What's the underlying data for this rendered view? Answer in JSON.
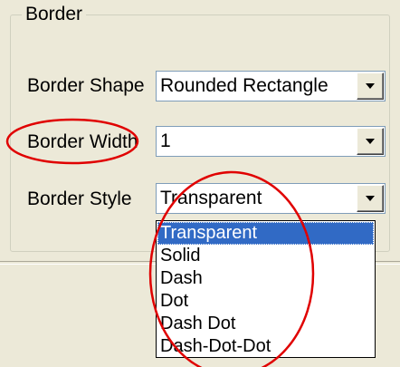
{
  "group": {
    "title": "Border"
  },
  "fields": {
    "shape": {
      "label": "Border Shape",
      "value": "Rounded Rectangle"
    },
    "width": {
      "label": "Border Width",
      "value": "1"
    },
    "style": {
      "label": "Border Style",
      "value": "Transparent"
    }
  },
  "dropdown": {
    "options": [
      "Transparent",
      "Solid",
      "Dash",
      "Dot",
      "Dash Dot",
      "Dash-Dot-Dot"
    ],
    "selected": "Transparent"
  },
  "colors": {
    "background": "#ece9d8",
    "selection": "#316ac5",
    "annotation": "#e00000"
  }
}
